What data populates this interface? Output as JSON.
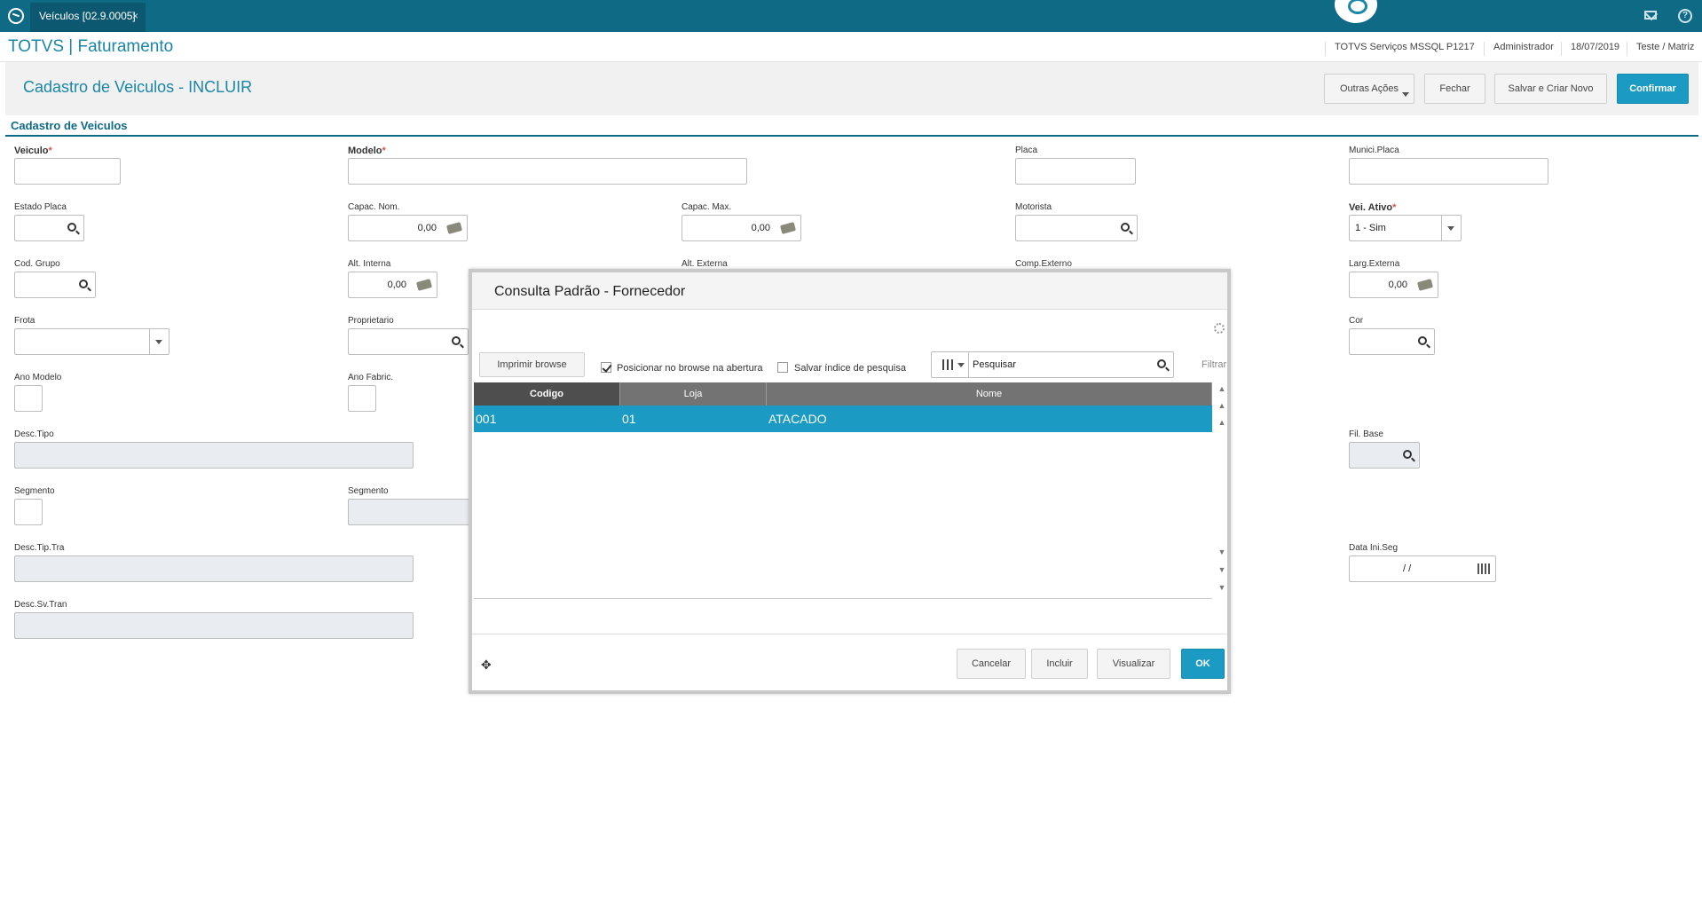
{
  "topbar": {
    "tab_label": "Veículos [02.9.0005]",
    "tab_close": "×",
    "help": "?"
  },
  "appbar": {
    "title": "TOTVS | Faturamento",
    "server": "TOTVS Serviços MSSQL P1217",
    "user": "Administrador",
    "date": "18/07/2019",
    "branch": "Teste / Matriz"
  },
  "actions": {
    "page_title": "Cadastro de Veiculos - INCLUIR",
    "outras": "Outras Ações",
    "fechar": "Fechar",
    "salvar_criar": "Salvar e Criar Novo",
    "confirmar": "Confirmar"
  },
  "form": {
    "section": "Cadastro de Veiculos",
    "veiculo": "Veiculo",
    "modelo": "Modelo",
    "placa": "Placa",
    "munici_placa": "Munici.Placa",
    "estado_placa": "Estado Placa",
    "capac_nom": "Capac. Nom.",
    "capac_nom_val": "0,00",
    "capac_max": "Capac. Max.",
    "capac_max_val": "0,00",
    "motorista": "Motorista",
    "vei_ativo": "Vei. Ativo",
    "vei_ativo_val": "1 - Sim",
    "cod_grupo": "Cod. Grupo",
    "alt_interna": "Alt. Interna",
    "alt_interna_val": "0,00",
    "alt_externa": "Alt. Externa",
    "comp_externo": "Comp.Externo",
    "larg_externa": "Larg.Externa",
    "larg_externa_val": "0,00",
    "frota": "Frota",
    "proprietario": "Proprietario",
    "cor": "Cor",
    "ano_modelo": "Ano Modelo",
    "ano_fabric": "Ano Fabric.",
    "desc_tipo": "Desc.Tipo",
    "fil_base": "Fil. Base",
    "segmento1": "Segmento",
    "segmento2": "Segmento",
    "desc_tip_tra": "Desc.Tip.Tra",
    "data_ini_seg": "Data Ini.Seg",
    "data_ini_seg_val": "/ /",
    "desc_sv_tran": "Desc.Sv.Tran",
    "required_mark": "*"
  },
  "modal": {
    "title": "Consulta Padrão - Fornecedor",
    "imprimir": "Imprimir browse",
    "posicionar": "Posicionar no browse na abertura",
    "salvar_indice": "Salvar índice de pesquisa",
    "pesquisar": "Pesquisar",
    "filtrar": "Filtrar",
    "columns": [
      "Codigo",
      "Loja",
      "Nome"
    ],
    "rows": [
      {
        "codigo": "001",
        "loja": "01",
        "nome": "ATACADO"
      }
    ],
    "cancelar": "Cancelar",
    "incluir": "Incluir",
    "visualizar": "Visualizar",
    "ok": "OK"
  }
}
